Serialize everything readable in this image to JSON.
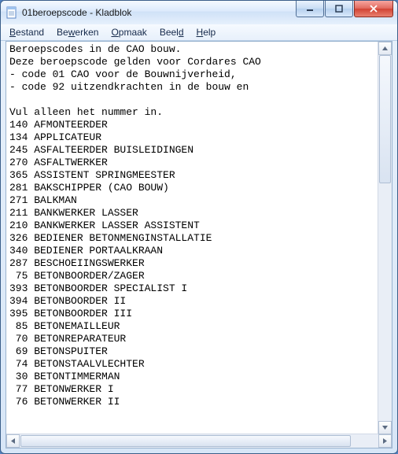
{
  "window": {
    "title": "01beroepscode - Kladblok"
  },
  "menubar": {
    "items": [
      {
        "accel": "B",
        "rest": "estand"
      },
      {
        "pre": "Be",
        "accel": "w",
        "rest": "erken"
      },
      {
        "accel": "O",
        "rest": "pmaak"
      },
      {
        "pre": "Beel",
        "accel": "d",
        "rest": ""
      },
      {
        "accel": "H",
        "rest": "elp"
      }
    ]
  },
  "document": {
    "intro": [
      "Beroepscodes in de CAO bouw.",
      "Deze beroepscode gelden voor Cordares CAO",
      "- code 01 CAO voor de Bouwnijverheid,",
      "- code 92 uitzendkrachten in de bouw en",
      "",
      "Vul alleen het nummer in."
    ],
    "codes": [
      {
        "code": "140",
        "name": "AFMONTEERDER"
      },
      {
        "code": "134",
        "name": "APPLICATEUR"
      },
      {
        "code": "245",
        "name": "ASFALTEERDER BUISLEIDINGEN"
      },
      {
        "code": "270",
        "name": "ASFALTWERKER"
      },
      {
        "code": "365",
        "name": "ASSISTENT SPRINGMEESTER"
      },
      {
        "code": "281",
        "name": "BAKSCHIPPER (CAO BOUW)"
      },
      {
        "code": "271",
        "name": "BALKMAN"
      },
      {
        "code": "211",
        "name": "BANKWERKER LASSER"
      },
      {
        "code": "210",
        "name": "BANKWERKER LASSER ASSISTENT"
      },
      {
        "code": "326",
        "name": "BEDIENER BETONMENGINSTALLATIE"
      },
      {
        "code": "340",
        "name": "BEDIENER PORTAALKRAAN"
      },
      {
        "code": "287",
        "name": "BESCHOEIINGSWERKER"
      },
      {
        "code": " 75",
        "name": "BETONBOORDER/ZAGER"
      },
      {
        "code": "393",
        "name": "BETONBOORDER SPECIALIST I"
      },
      {
        "code": "394",
        "name": "BETONBOORDER II"
      },
      {
        "code": "395",
        "name": "BETONBOORDER III"
      },
      {
        "code": " 85",
        "name": "BETONEMAILLEUR"
      },
      {
        "code": " 70",
        "name": "BETONREPARATEUR"
      },
      {
        "code": " 69",
        "name": "BETONSPUITER"
      },
      {
        "code": " 74",
        "name": "BETONSTAALVLECHTER"
      },
      {
        "code": " 30",
        "name": "BETONTIMMERMAN"
      },
      {
        "code": " 77",
        "name": "BETONWERKER I"
      },
      {
        "code": " 76",
        "name": "BETONWERKER II"
      }
    ]
  }
}
